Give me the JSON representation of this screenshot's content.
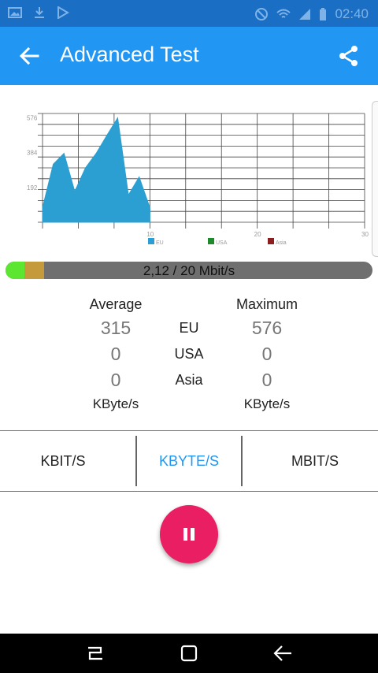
{
  "statusbar": {
    "time": "02:40",
    "left_icons": [
      "image-icon",
      "download-icon",
      "play-store-icon"
    ],
    "right_icons": [
      "do-not-disturb-icon",
      "wifi-icon",
      "signal-icon",
      "battery-icon"
    ]
  },
  "appbar": {
    "title": "Advanced Test",
    "back_icon": "arrow-left-icon",
    "share_icon": "share-icon"
  },
  "chart_data": {
    "type": "area",
    "title": "",
    "y_tick_labels": [
      "576",
      "384",
      "192"
    ],
    "x_tick_labels": [
      "10",
      "20",
      "30"
    ],
    "xlim": [
      0,
      30
    ],
    "ylim": [
      0,
      600
    ],
    "grid": true,
    "legend_position": "bottom",
    "series": [
      {
        "name": "EU",
        "color": "#2b9fd1",
        "x": [
          0,
          1,
          2,
          3,
          4,
          5,
          6,
          7,
          8,
          9,
          10
        ],
        "y": [
          80,
          320,
          380,
          170,
          300,
          380,
          480,
          576,
          150,
          250,
          80
        ]
      },
      {
        "name": "USA",
        "color": "#1d8a2b",
        "x": [],
        "y": []
      },
      {
        "name": "Asia",
        "color": "#8b1e1e",
        "x": [],
        "y": []
      }
    ]
  },
  "progress": {
    "text": "2,12 / 20 Mbit/s",
    "value_mbit": 2.12,
    "max_mbit": 20
  },
  "stats": {
    "average_label": "Average",
    "maximum_label": "Maximum",
    "unit_left": "KByte/s",
    "unit_right": "KByte/s",
    "rows": [
      {
        "region": "EU",
        "average": "315",
        "maximum": "576"
      },
      {
        "region": "USA",
        "average": "0",
        "maximum": "0"
      },
      {
        "region": "Asia",
        "average": "0",
        "maximum": "0"
      }
    ]
  },
  "tabs": [
    {
      "label": "KBIT/S",
      "active": false
    },
    {
      "label": "KBYTE/S",
      "active": true
    },
    {
      "label": "MBIT/S",
      "active": false
    }
  ],
  "fab": {
    "icon": "pause-icon"
  },
  "navbar": {
    "icons": [
      "recent-apps-icon",
      "home-icon",
      "back-icon"
    ]
  },
  "colors": {
    "accent": "#2196f3",
    "fab": "#e91e63",
    "status_bar": "#1a6fc4"
  }
}
